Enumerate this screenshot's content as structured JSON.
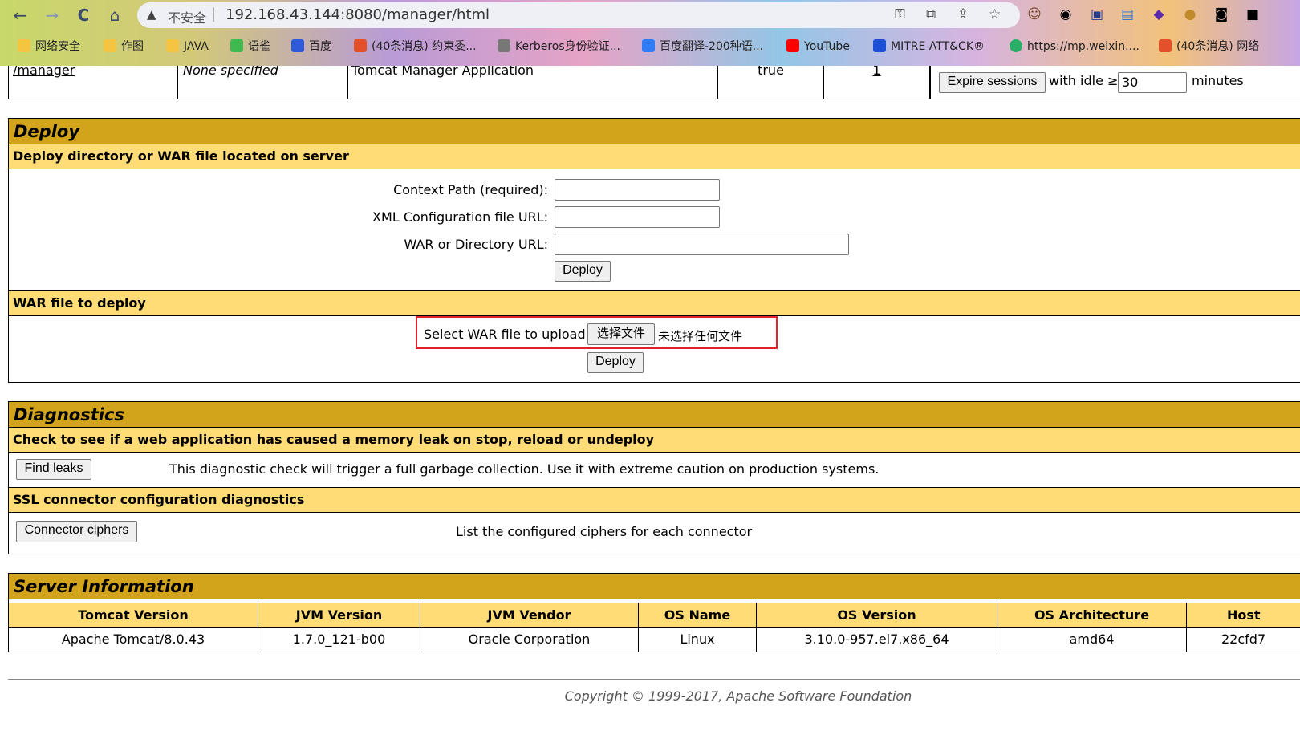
{
  "browser": {
    "back": "←",
    "forward": "→",
    "reload": "C",
    "home": "⌂",
    "insecure_label": "不安全",
    "separator": "|",
    "url": "192.168.43.144:8080/manager/html",
    "bookmarks": [
      {
        "label": "网络安全",
        "color": "#f5c542"
      },
      {
        "label": "作图",
        "color": "#f5c542"
      },
      {
        "label": "JAVA",
        "color": "#f5c542"
      },
      {
        "label": "语雀",
        "color": "#3fb950"
      },
      {
        "label": "百度",
        "color": "#2f5bd9"
      },
      {
        "label": "(40条消息) 约束委...",
        "color": "#e2502c"
      },
      {
        "label": "Kerberos身份验证...",
        "color": "#555555"
      },
      {
        "label": "百度翻译-200种语...",
        "color": "#2f7cf6"
      },
      {
        "label": "YouTube",
        "color": "#ff0000"
      },
      {
        "label": "MITRE ATT&CK®",
        "color": "#1d4ed8"
      },
      {
        "label": "https://mp.weixin....",
        "color": "#2aae67"
      },
      {
        "label": "(40条消息) 网络",
        "color": "#e2502c"
      }
    ]
  },
  "apps_row": {
    "path": "/manager",
    "version": "None specified",
    "display_name": "Tomcat Manager Application",
    "running": "true",
    "sessions": "1",
    "expire_button": "Expire sessions",
    "with_idle": "with idle ≥",
    "idle_value": "30",
    "minutes": "minutes"
  },
  "deploy": {
    "title": "Deploy",
    "server_heading": "Deploy directory or WAR file located on server",
    "context_label": "Context Path (required):",
    "xml_label": "XML Configuration file URL:",
    "war_dir_label": "WAR or Directory URL:",
    "deploy_button": "Deploy",
    "war_heading": "WAR file to deploy",
    "select_label": "Select WAR file to upload",
    "choose_button": "选择文件",
    "no_file": "未选择任何文件",
    "upload_deploy_button": "Deploy",
    "highlight_color": "#e0202a"
  },
  "diagnostics": {
    "title": "Diagnostics",
    "leak_heading": "Check to see if a web application has caused a memory leak on stop, reload or undeploy",
    "find_leaks_button": "Find leaks",
    "leak_desc": "This diagnostic check will trigger a full garbage collection. Use it with extreme caution on production systems.",
    "ssl_heading": "SSL connector configuration diagnostics",
    "ciphers_button": "Connector ciphers",
    "ciphers_desc": "List the configured ciphers for each connector"
  },
  "server_info": {
    "title": "Server Information",
    "headers": [
      "Tomcat Version",
      "JVM Version",
      "JVM Vendor",
      "OS Name",
      "OS Version",
      "OS Architecture",
      "Host"
    ],
    "values": [
      "Apache Tomcat/8.0.43",
      "1.7.0_121-b00",
      "Oracle Corporation",
      "Linux",
      "3.10.0-957.el7.x86_64",
      "amd64",
      "22cfd7"
    ]
  },
  "footer": {
    "copyright": "Copyright © 1999-2017, Apache Software Foundation"
  },
  "colors": {
    "title_bar": "#d2a41c",
    "sub_bar": "#ffdc75"
  }
}
